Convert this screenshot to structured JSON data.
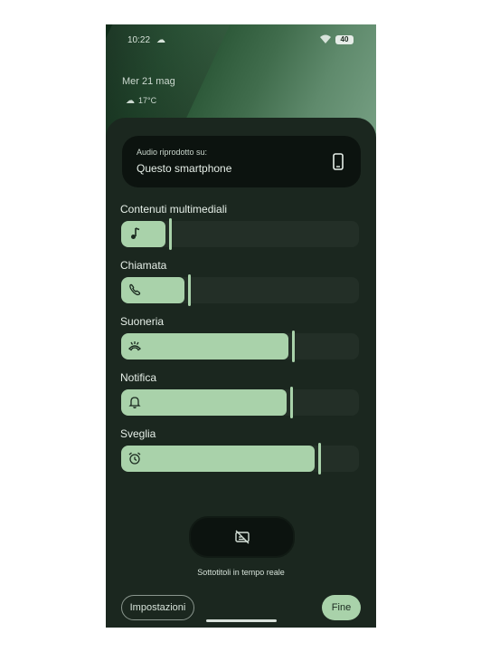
{
  "status_bar": {
    "time": "10:22",
    "battery": "40",
    "weather_icon": "cloud-icon",
    "network_icon": "wifi-icon"
  },
  "lockscreen": {
    "date": "Mer 21 mag",
    "temperature": "17°C"
  },
  "output": {
    "label": "Audio riprodotto su:",
    "device": "Questo smartphone",
    "icon": "smartphone-icon"
  },
  "volumes": [
    {
      "label": "Contenuti multimediali",
      "icon": "music-note-icon",
      "level": 0.2
    },
    {
      "label": "Chiamata",
      "icon": "phone-call-icon",
      "level": 0.28
    },
    {
      "label": "Suoneria",
      "icon": "ringer-icon",
      "level": 0.72
    },
    {
      "label": "Notifica",
      "icon": "bell-icon",
      "level": 0.71
    },
    {
      "label": "Sveglia",
      "icon": "alarm-clock-icon",
      "level": 0.83
    }
  ],
  "live_caption": {
    "label": "Sottotitoli in tempo reale",
    "icon": "captions-off-icon"
  },
  "buttons": {
    "settings": "Impostazioni",
    "done": "Fine"
  },
  "colors": {
    "accent": "#a9d2aa",
    "panel": "#1b271f",
    "track": "#232f27"
  }
}
